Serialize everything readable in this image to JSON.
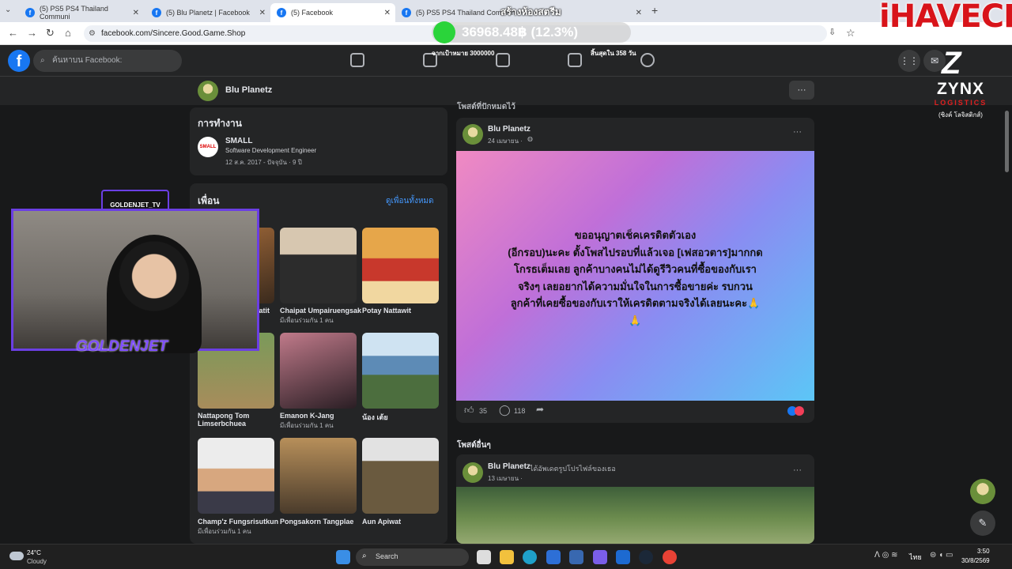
{
  "browser": {
    "tabs": [
      {
        "label": "(5) PS5 PS4 Thailand Communi"
      },
      {
        "label": "(5) Blu Planetz | Facebook"
      },
      {
        "label": "(5) Facebook"
      },
      {
        "label": "(5) PS5 PS4 Thailand Commun"
      }
    ],
    "new_tab": "+",
    "url": "facebook.com/Sincere.Good.Game.Shop"
  },
  "overlay": {
    "stream_banner": "สร้างห้องสตรีม",
    "price": "36968.48฿ (12.3%)",
    "target_text": "จากเป้าหมาย 3000000",
    "days_left": "สิ้นสุดใน 358 วัน",
    "ihavecpu": "iHAVECPU",
    "zynx": "ZYNX",
    "zynx_sub": "LOGISTICS",
    "zynx_thai": "(ซิงค์ โลจิสติกส์)",
    "webcam_name": "GOLDENJET_TV",
    "webcam_logo": "GOLDENJET"
  },
  "fb": {
    "search_placeholder": "ค้นหาบน Facebook:",
    "profile_name": "Blu Planetz",
    "more": "···"
  },
  "work": {
    "heading": "การทำงาน",
    "company": "SMALL",
    "company_logo": "SMALL",
    "role": "Software Development Engineer",
    "dates": "12 ส.ค. 2017 - ปัจจุบัน · 9 ปี"
  },
  "friends": {
    "heading": "เพื่อน",
    "see_all": "ดูเพื่อนทั้งหมด",
    "items": [
      {
        "name": "...atit",
        "mutual": ""
      },
      {
        "name": "Chaipat Umpairuengsak",
        "mutual": "มีเพื่อนร่วมกัน 1 คน"
      },
      {
        "name": "Potay Nattawit",
        "mutual": ""
      },
      {
        "name": "Nattapong Tom Limserbchuea",
        "mutual": ""
      },
      {
        "name": "Emanon K-Jang",
        "mutual": "มีเพื่อนร่วมกัน 1 คน"
      },
      {
        "name": "น้อง เต้ย",
        "mutual": ""
      },
      {
        "name": "Champ'z Fungsrisutkun",
        "mutual": "มีเพื่อนร่วมกัน 1 คน"
      },
      {
        "name": "Pongsakorn Tangplae",
        "mutual": ""
      },
      {
        "name": "Aun Apiwat",
        "mutual": ""
      }
    ]
  },
  "feed": {
    "pinned_label": "โพสต์ที่ปักหมุดไว้",
    "post1": {
      "author": "Blu Planetz",
      "date": "24 เมษายน ·",
      "text_lines": [
        "ขออนุญาตเช็คเครดิตตัวเอง",
        "(อีกรอบ)นะคะ ตั้งโพสไปรอบที่แล้วเจอ [เฟสอวตาร]มากกด",
        "โกรธเต็มเลย ลูกค้าบางคนไม่ได้ดูรีวิวคนที่ซื้อของกับเรา",
        "จริงๆ เลยอยากได้ความมั่นใจในการซื้อขายค่ะ รบกวน",
        "ลูกค้าที่เคยซื้อของกับเราให้เครดิตตามจริงได้เลยนะคะ🙏",
        "🙏"
      ],
      "likes": "35",
      "comments": "118"
    },
    "other_label": "โพสต์อื่นๆ",
    "post2": {
      "author": "Blu Planetz",
      "action": "ได้อัพเดตรูปโปรไฟล์ของเธอ",
      "date": "13 เมษายน ·"
    }
  },
  "taskbar": {
    "temp": "24°C",
    "weather": "Cloudy",
    "search": "Search",
    "lang": "ไทย",
    "time": "3:50",
    "date": "30/8/2569"
  }
}
